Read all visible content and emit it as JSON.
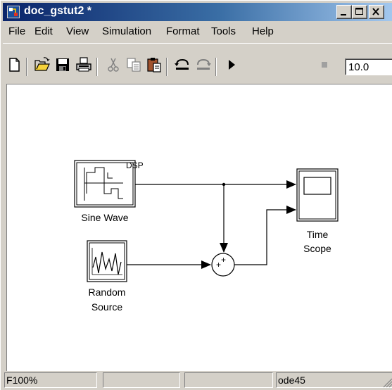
{
  "window": {
    "title": "doc_gstut2 *"
  },
  "menu": {
    "items": [
      "File",
      "Edit",
      "View",
      "Simulation",
      "Format",
      "Tools",
      "Help"
    ]
  },
  "toolbar": {
    "stop_time": "10.0",
    "icons": [
      "new-model-icon",
      "open-icon",
      "save-icon",
      "print-icon",
      "cut-icon",
      "copy-icon",
      "paste-icon",
      "undo-icon",
      "redo-icon",
      "start-simulation-icon",
      "stop-simulation-icon"
    ]
  },
  "diagram": {
    "blocks": {
      "sine_wave": {
        "label": "Sine Wave",
        "badge": "DSP"
      },
      "random_source": {
        "label_line1": "Random",
        "label_line2": "Source"
      },
      "sum": {
        "signs": "++"
      },
      "time_scope": {
        "label_line1": "Time",
        "label_line2": "Scope"
      }
    }
  },
  "statusbar": {
    "left_char": "F",
    "zoom": "100%",
    "field2": "",
    "field3": "",
    "solver": "ode45"
  },
  "colors": {
    "titlebar_start": "#0a246a",
    "titlebar_end": "#a6caf0",
    "chrome": "#d4d0c8",
    "canvas": "#ffffff"
  }
}
